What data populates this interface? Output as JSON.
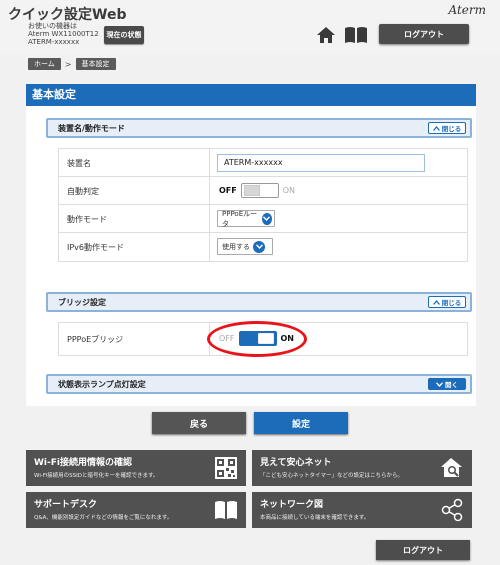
{
  "header": {
    "app_title": "クイック設定Web",
    "device_info_line1": "お使いの機器は",
    "device_info_line2": "Aterm WX11000T12",
    "device_info_line3": "ATERM-xxxxxx",
    "status_button": "現在の状態",
    "brand": "Aterm",
    "logout_label": "ログアウト"
  },
  "breadcrumb": [
    "ホーム",
    "基本設定"
  ],
  "page_title": "基本設定",
  "groups": {
    "device": {
      "title": "装置名/動作モード",
      "toggle_label": "閉じる",
      "rows": {
        "name_label": "装置名",
        "name_value": "ATERM-xxxxxx",
        "auto_label": "自動判定",
        "auto_off": "OFF",
        "auto_on": "ON",
        "mode_label": "動作モード",
        "mode_value": "PPPoEルータ",
        "ipv6_label": "IPv6動作モード",
        "ipv6_value": "使用する"
      }
    },
    "bridge": {
      "title": "ブリッジ設定",
      "toggle_label": "閉じる",
      "pppoe_label": "PPPoEブリッジ",
      "pppoe_off": "OFF",
      "pppoe_on": "ON"
    },
    "lamp": {
      "title": "状態表示ランプ点灯設定",
      "toggle_label": "開く"
    }
  },
  "actions": {
    "back": "戻る",
    "apply": "設定"
  },
  "tiles": [
    {
      "title": "Wi-Fi接続用情報の確認",
      "desc": "Wi-Fi接続用のSSIDと暗号化キーを確認できます。",
      "icon": "qr-code-icon"
    },
    {
      "title": "見えて安心ネット",
      "desc": "「こども安心ネットタイマー」などの設定はこちらから。",
      "icon": "house-search-icon"
    },
    {
      "title": "サポートデスク",
      "desc": "Q&A、機能別設定ガイドなどの情報をご覧になれます。",
      "icon": "book-icon"
    },
    {
      "title": "ネットワーク図",
      "desc": "本商品に接続している端末を確認できます。",
      "icon": "network-icon"
    }
  ],
  "footer": {
    "logout_label": "ログアウト"
  },
  "colors": {
    "accent": "#1c6cba",
    "highlight": "#e8141a",
    "dark_button": "#4d4d4d"
  }
}
